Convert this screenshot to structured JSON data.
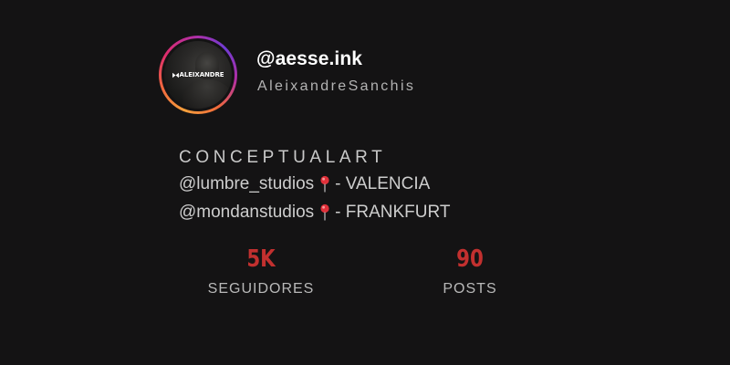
{
  "profile": {
    "username": "@aesse.ink",
    "full_name": "AleixandreSanchis",
    "avatar_logo_text": "ALEIXANDRE"
  },
  "bio": {
    "line1": "CONCEPTUALART",
    "line2_handle": "@lumbre_studios",
    "line2_location": "- VALENCIA",
    "line3_handle": "@mondanstudios",
    "line3_location": "- FRANKFURT",
    "pin_icon": "round-pushpin-icon"
  },
  "stats": {
    "followers_value": "5K",
    "followers_label": "SEGUIDORES",
    "posts_value": "90",
    "posts_label": "POSTS"
  },
  "colors": {
    "background": "#141314",
    "stat_accent": "#c2302f",
    "pin_red": "#e0303a"
  }
}
